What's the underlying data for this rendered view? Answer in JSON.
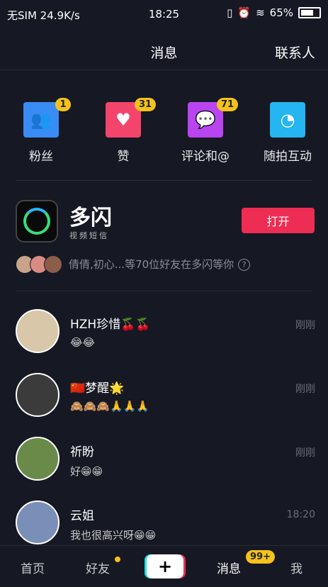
{
  "status_bar": {
    "sim": "无SIM",
    "speed": "24.9K/s",
    "time": "18:25",
    "battery": "65%"
  },
  "header": {
    "title": "消息",
    "contacts": "联系人"
  },
  "quick_actions": [
    {
      "label": "粉丝",
      "badge": "1",
      "icon": "fans-icon",
      "color": "#3a8cf5"
    },
    {
      "label": "赞",
      "badge": "31",
      "icon": "heart-icon",
      "color": "#f3456b"
    },
    {
      "label": "评论和@",
      "badge": "71",
      "icon": "comment-icon",
      "color": "#b945f0"
    },
    {
      "label": "随拍互动",
      "badge": "",
      "icon": "camera-interact-icon",
      "color": "#25b5f0"
    }
  ],
  "promo": {
    "app_name": "多闪",
    "app_sub": "视频短信",
    "open_label": "打开",
    "note": "倩倩,初心...等70位好友在多闪等你"
  },
  "conversations": [
    {
      "name": "HZH珍惜🍒🍒",
      "message": "😂😂",
      "time": "刚刚"
    },
    {
      "name": "🇨🇳梦醒🌟",
      "message": "🙈🙈🙈🙏🙏🙏",
      "time": "刚刚"
    },
    {
      "name": "祈盼",
      "message": "好😁😁",
      "time": "刚刚"
    },
    {
      "name": "云姐",
      "message": "我也很高兴呀😁😁",
      "time": "18:20"
    }
  ],
  "tabbar": {
    "home": "首页",
    "friends": "好友",
    "add": "+",
    "messages": "消息",
    "messages_badge": "99+",
    "me": "我"
  }
}
